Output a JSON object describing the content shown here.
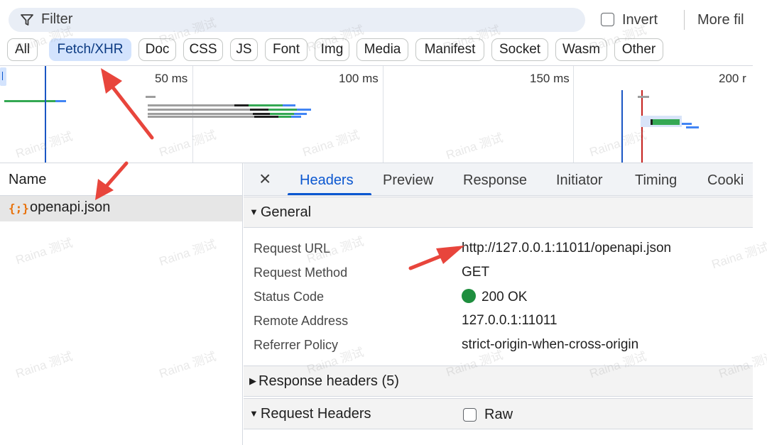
{
  "filter_bar": {
    "placeholder": "Filter",
    "invert_label": "Invert",
    "more_filters_label": "More fil"
  },
  "type_chips": [
    {
      "label": "All",
      "active": false
    },
    {
      "label": "Fetch/XHR",
      "active": true
    },
    {
      "label": "Doc",
      "active": false
    },
    {
      "label": "CSS",
      "active": false
    },
    {
      "label": "JS",
      "active": false
    },
    {
      "label": "Font",
      "active": false
    },
    {
      "label": "Img",
      "active": false
    },
    {
      "label": "Media",
      "active": false
    },
    {
      "label": "Manifest",
      "active": false
    },
    {
      "label": "Socket",
      "active": false
    },
    {
      "label": "Wasm",
      "active": false
    },
    {
      "label": "Other",
      "active": false
    }
  ],
  "overview": {
    "tick_labels": [
      "50 ms",
      "100 ms",
      "150 ms",
      "200 r"
    ]
  },
  "request_list": {
    "column_name": "Name",
    "rows": [
      {
        "icon": "json-file-icon",
        "icon_glyph": "{;}",
        "name": "openapi.json",
        "selected": true
      }
    ]
  },
  "details": {
    "close_glyph": "×",
    "tabs": [
      {
        "label": "Headers",
        "active": true
      },
      {
        "label": "Preview",
        "active": false
      },
      {
        "label": "Response",
        "active": false
      },
      {
        "label": "Initiator",
        "active": false
      },
      {
        "label": "Timing",
        "active": false
      },
      {
        "label": "Cooki",
        "active": false
      }
    ],
    "general": {
      "title": "General",
      "expanded": true,
      "rows": [
        {
          "key": "Request URL",
          "value": "http://127.0.0.1:11011/openapi.json"
        },
        {
          "key": "Request Method",
          "value": "GET"
        },
        {
          "key": "Status Code",
          "value": "200 OK"
        },
        {
          "key": "Remote Address",
          "value": "127.0.0.1:11011"
        },
        {
          "key": "Referrer Policy",
          "value": "strict-origin-when-cross-origin"
        }
      ]
    },
    "response_headers": {
      "title": "Response headers (5)",
      "expanded": false
    },
    "request_headers": {
      "title": "Request Headers",
      "expanded": true,
      "raw_label": "Raw"
    }
  },
  "watermark": "Raina 测试",
  "colors": {
    "accent": "#0b57d0",
    "chip_active_bg": "#d3e3fd",
    "status_ok": "#1e8e3e",
    "json_icon": "#e8710a",
    "annotation_arrow": "#e8453c"
  }
}
